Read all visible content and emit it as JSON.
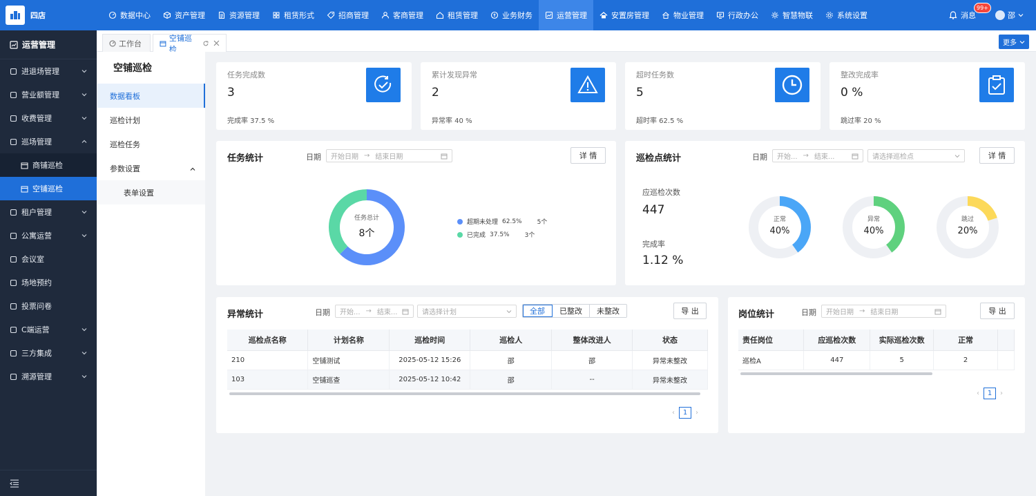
{
  "header": {
    "store_name": "四店",
    "nav": [
      {
        "label": "数据中心",
        "icon": "dashboard-icon"
      },
      {
        "label": "资产管理",
        "icon": "cube-icon"
      },
      {
        "label": "资源管理",
        "icon": "document-icon"
      },
      {
        "label": "租赁形式",
        "icon": "grid-icon"
      },
      {
        "label": "招商管理",
        "icon": "tag-icon"
      },
      {
        "label": "客商管理",
        "icon": "people-icon"
      },
      {
        "label": "租赁管理",
        "icon": "home-icon"
      },
      {
        "label": "业务财务",
        "icon": "coin-icon"
      },
      {
        "label": "运营管理",
        "icon": "ops-icon"
      },
      {
        "label": "安置房管理",
        "icon": "house-icon"
      },
      {
        "label": "物业管理",
        "icon": "building-icon"
      },
      {
        "label": "行政办公",
        "icon": "monitor-icon"
      },
      {
        "label": "智慧物联",
        "icon": "iot-icon"
      },
      {
        "label": "系统设置",
        "icon": "gear-icon"
      }
    ],
    "messages_label": "消息",
    "messages_badge": "99+",
    "user_name": "邵"
  },
  "sidebar": {
    "title": "运营管理",
    "items": [
      {
        "label": "进退场管理"
      },
      {
        "label": "营业额管理"
      },
      {
        "label": "收费管理"
      },
      {
        "label": "巡场管理"
      },
      {
        "label": "商铺巡检"
      },
      {
        "label": "空铺巡检"
      },
      {
        "label": "租户管理"
      },
      {
        "label": "公寓运营"
      },
      {
        "label": "会议室"
      },
      {
        "label": "场地预约"
      },
      {
        "label": "投票问卷"
      },
      {
        "label": "C端运营"
      },
      {
        "label": "三方集成"
      },
      {
        "label": "溯源管理"
      }
    ]
  },
  "tabs": {
    "workbench": "工作台",
    "current": "空铺巡检",
    "more": "更多"
  },
  "subnav": {
    "title": "空铺巡检",
    "items": [
      "数据看板",
      "巡检计划",
      "巡检任务",
      "参数设置",
      "表单设置"
    ]
  },
  "kpis": [
    {
      "label": "任务完成数",
      "value": "3",
      "sub": "完成率  37.5 %"
    },
    {
      "label": "累计发现异常",
      "value": "2",
      "sub": "异常率  40 %"
    },
    {
      "label": "超时任务数",
      "value": "5",
      "sub": "超时率  62.5 %"
    },
    {
      "label": "整改完成率",
      "value": "0 %",
      "sub": "跳过率  20 %"
    }
  ],
  "common": {
    "date_label": "日期",
    "start_date": "开始日期",
    "end_date": "结束日期",
    "start_short": "开始...",
    "end_short": "结束...",
    "arrow": "→",
    "detail": "详 情",
    "export": "导 出"
  },
  "task_stats": {
    "title": "任务统计",
    "center_label": "任务总计",
    "center_value": "8个",
    "legend": [
      {
        "label": "超期未处理",
        "pct": "62.5%",
        "count": "5个",
        "color": "#5b8ff9"
      },
      {
        "label": "已完成",
        "pct": "37.5%",
        "count": "3个",
        "color": "#5ad8a6"
      }
    ]
  },
  "point_stats": {
    "title": "巡检点统计",
    "select_placeholder": "请选择巡检点",
    "should_label": "应巡检次数",
    "should_value": "447",
    "rate_label": "完成率",
    "rate_value": "1.12 %",
    "rings": [
      {
        "label": "正常",
        "value": "40%",
        "fraction": 0.4,
        "color": "#4aa6f7"
      },
      {
        "label": "异常",
        "value": "40%",
        "fraction": 0.4,
        "color": "#5fd17e"
      },
      {
        "label": "跳过",
        "value": "20%",
        "fraction": 0.2,
        "color": "#fcd95a"
      }
    ]
  },
  "anomaly": {
    "title": "异常统计",
    "plan_placeholder": "请选择计划",
    "filters": [
      "全部",
      "已整改",
      "未整改"
    ],
    "columns": [
      "巡检点名称",
      "计划名称",
      "巡检时间",
      "巡检人",
      "整体改进人",
      "状态"
    ],
    "rows": [
      [
        "210",
        "空铺测试",
        "2025-05-12 15:26",
        "邵",
        "邵",
        "异常未整改"
      ],
      [
        "103",
        "空铺巡查",
        "2025-05-12 10:42",
        "邵",
        "--",
        "异常未整改"
      ]
    ],
    "page": "1"
  },
  "post_stats": {
    "title": "岗位统计",
    "columns": [
      "责任岗位",
      "应巡检次数",
      "实际巡检次数",
      "正常"
    ],
    "rows": [
      [
        "巡检A",
        "447",
        "5",
        "2"
      ]
    ],
    "page": "1"
  },
  "chart_data": [
    {
      "type": "pie",
      "title": "任务统计",
      "categories": [
        "超期未处理",
        "已完成"
      ],
      "values": [
        5,
        3
      ]
    },
    {
      "type": "pie",
      "title": "巡检点统计",
      "categories": [
        "正常",
        "异常",
        "跳过"
      ],
      "values": [
        40,
        40,
        20
      ]
    }
  ]
}
